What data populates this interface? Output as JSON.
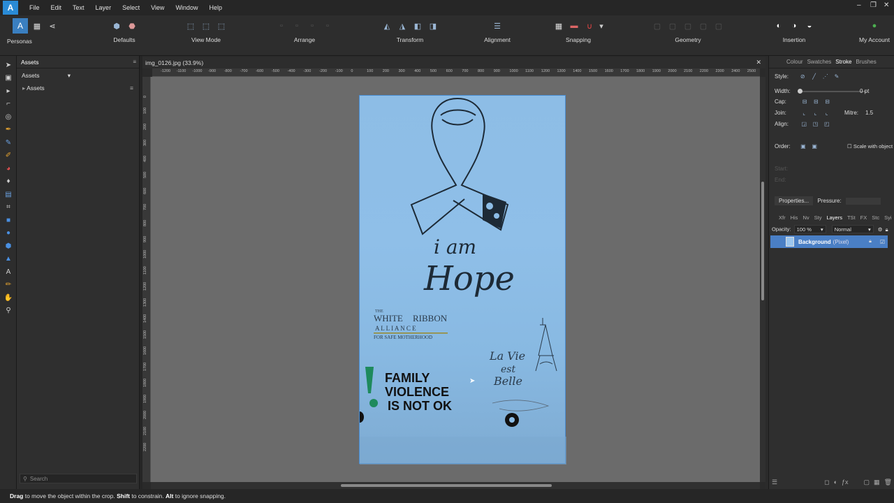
{
  "menubar": {
    "items": [
      "File",
      "Edit",
      "Text",
      "Layer",
      "Select",
      "View",
      "Window",
      "Help"
    ]
  },
  "toolbar": {
    "personas": "Personas",
    "defaults": "Defaults",
    "view_mode": "View Mode",
    "arrange": "Arrange",
    "transform": "Transform",
    "alignment": "Alignment",
    "snapping": "Snapping",
    "geometry": "Geometry",
    "insertion": "Insertion",
    "my_account": "My Account"
  },
  "assets_panel": {
    "tab": "Assets",
    "dropdown": "Assets",
    "section": "Assets",
    "search_placeholder": "Search"
  },
  "document": {
    "title": "img_0126.jpg (33.9%)",
    "h_ruler": [
      "-1200",
      "-1100",
      "-1000",
      "-900",
      "-800",
      "-700",
      "-600",
      "-500",
      "-400",
      "-300",
      "-200",
      "-100",
      "0",
      "100",
      "200",
      "300",
      "400",
      "500",
      "600",
      "700",
      "800",
      "900",
      "1000",
      "1100",
      "1200",
      "1300",
      "1400",
      "1500",
      "1600",
      "1700",
      "1800",
      "1900",
      "2000",
      "2100",
      "2200",
      "2300",
      "2400",
      "2500"
    ],
    "v_ruler": [
      "0",
      "100",
      "200",
      "300",
      "400",
      "500",
      "600",
      "700",
      "800",
      "900",
      "1000",
      "1100",
      "1200",
      "1300",
      "1400",
      "1500",
      "1600",
      "1700",
      "1800",
      "1900",
      "2000",
      "2100",
      "2200"
    ]
  },
  "poster": {
    "line1": "i am",
    "line2": "Hope",
    "org_the": "THE",
    "org_white": "WHITE",
    "org_ribbon": "RIBBON",
    "org_alliance": "A L L I A N C E",
    "org_tag": "FOR SAFE MOTHERHOOD",
    "fv1": "FAMILY",
    "fv2": "VIOLENCE",
    "fv3": "IS NOT OK",
    "script1": "La Vie",
    "script2": "est",
    "script3": "Belle"
  },
  "right_panel": {
    "tabs": [
      "Colour",
      "Swatches",
      "Stroke",
      "Brushes"
    ],
    "active_tab": "Stroke",
    "style_label": "Style:",
    "width_label": "Width:",
    "width_value": "0 pt",
    "cap_label": "Cap:",
    "join_label": "Join:",
    "mitre_label": "Mitre:",
    "mitre_value": "1.5",
    "align_label": "Align:",
    "order_label": "Order:",
    "scale_label": "Scale with object",
    "start_label": "Start:",
    "end_label": "End:",
    "properties": "Properties...",
    "pressure": "Pressure:"
  },
  "layers_panel": {
    "tabs": [
      "Xfr",
      "His",
      "Nv",
      "Sty",
      "Layers",
      "TSt",
      "FX",
      "Stc",
      "Syi"
    ],
    "active_tab": "Layers",
    "opacity_label": "Opacity:",
    "opacity_value": "100 %",
    "blend_mode": "Normal",
    "layer_name": "Background",
    "layer_type": "(Pixel)"
  },
  "status": {
    "drag": "Drag",
    "text1": " to move the object within the crop. ",
    "shift": "Shift",
    "text2": " to constrain. ",
    "alt": "Alt",
    "text3": " to ignore snapping."
  },
  "colors": {
    "accent": "#3a7fc0",
    "photo_blue": "#8dbde6",
    "selection": "#4a7fc5"
  }
}
